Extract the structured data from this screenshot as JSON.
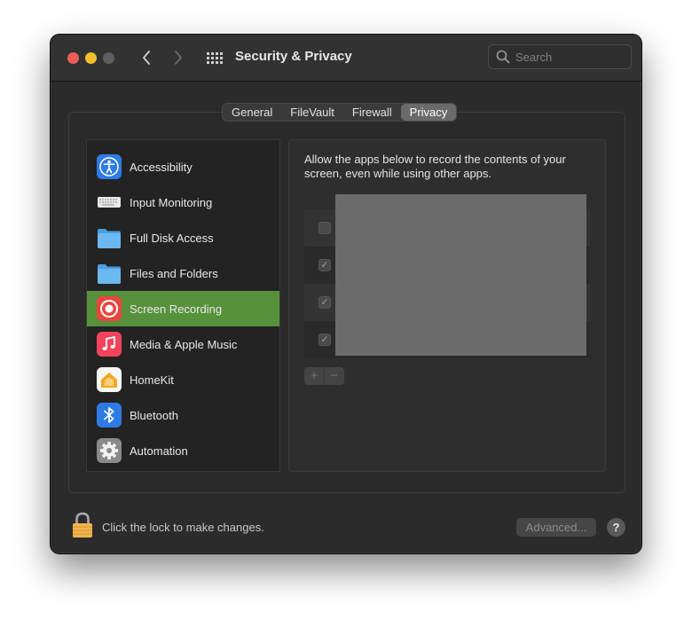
{
  "window": {
    "title": "Security & Privacy",
    "search_placeholder": "Search"
  },
  "tabs": [
    {
      "label": "General",
      "active": false
    },
    {
      "label": "FileVault",
      "active": false
    },
    {
      "label": "Firewall",
      "active": false
    },
    {
      "label": "Privacy",
      "active": true
    }
  ],
  "sidebar": {
    "items": [
      {
        "label": "Accessibility",
        "icon": "accessibility-icon",
        "selected": false
      },
      {
        "label": "Input Monitoring",
        "icon": "keyboard-icon",
        "selected": false
      },
      {
        "label": "Full Disk Access",
        "icon": "folder-icon",
        "selected": false
      },
      {
        "label": "Files and Folders",
        "icon": "folder-icon",
        "selected": false
      },
      {
        "label": "Screen Recording",
        "icon": "screen-recording-icon",
        "selected": true
      },
      {
        "label": "Media & Apple Music",
        "icon": "music-icon",
        "selected": false
      },
      {
        "label": "HomeKit",
        "icon": "homekit-icon",
        "selected": false
      },
      {
        "label": "Bluetooth",
        "icon": "bluetooth-icon",
        "selected": false
      },
      {
        "label": "Automation",
        "icon": "gear-icon",
        "selected": false
      }
    ]
  },
  "content": {
    "description": "Allow the apps below to record the contents of your screen, even while using other apps.",
    "rows": [
      {
        "checked": false
      },
      {
        "checked": true
      },
      {
        "checked": true
      },
      {
        "checked": true
      }
    ],
    "add_label": "+",
    "remove_label": "−"
  },
  "footer": {
    "lock_text": "Click the lock to make changes.",
    "advanced_label": "Advanced...",
    "help_label": "?"
  },
  "colors": {
    "selected": "#57913c",
    "close": "#ee5e56",
    "minimize": "#f3be2e"
  }
}
